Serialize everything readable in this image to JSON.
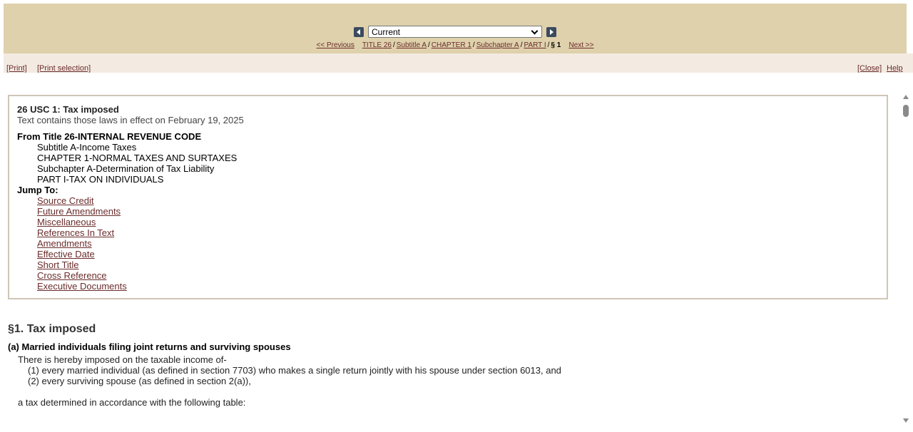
{
  "nav": {
    "version_select": "Current",
    "previous": "<< Previous",
    "next": "Next >>",
    "breadcrumbs": [
      "TITLE 26",
      "Subtitle A",
      "CHAPTER 1",
      "Subchapter A",
      "PART I"
    ],
    "current": "§ 1",
    "separator": "/"
  },
  "toolbar": {
    "print": "[Print]",
    "print_selection": "[Print selection]",
    "close": "[Close]",
    "help": "Help"
  },
  "info": {
    "title": "26 USC 1: Tax imposed",
    "effective": "Text contains those laws in effect on February 19, 2025",
    "from": "From Title 26-INTERNAL REVENUE CODE",
    "hierarchy": [
      "Subtitle A-Income Taxes",
      "CHAPTER 1-NORMAL TAXES AND SURTAXES",
      "Subchapter A-Determination of Tax Liability",
      "PART I-TAX ON INDIVIDUALS"
    ],
    "jump_label": "Jump To:",
    "jump_links": [
      "Source Credit",
      "Future Amendments",
      "Miscellaneous",
      "References In Text",
      "Amendments",
      "Effective Date",
      "Short Title",
      "Cross Reference",
      "Executive Documents"
    ]
  },
  "section": {
    "title": "§1. Tax imposed",
    "subsection_a": "(a) Married individuals filing joint returns and surviving spouses",
    "lines": [
      "There is hereby imposed on the taxable income of-",
      "(1) every married individual (as defined in section 7703) who makes a single return jointly with his spouse under section 6013, and",
      "(2) every surviving spouse (as defined in section 2(a)),",
      "a tax determined in accordance with the following table:"
    ]
  }
}
